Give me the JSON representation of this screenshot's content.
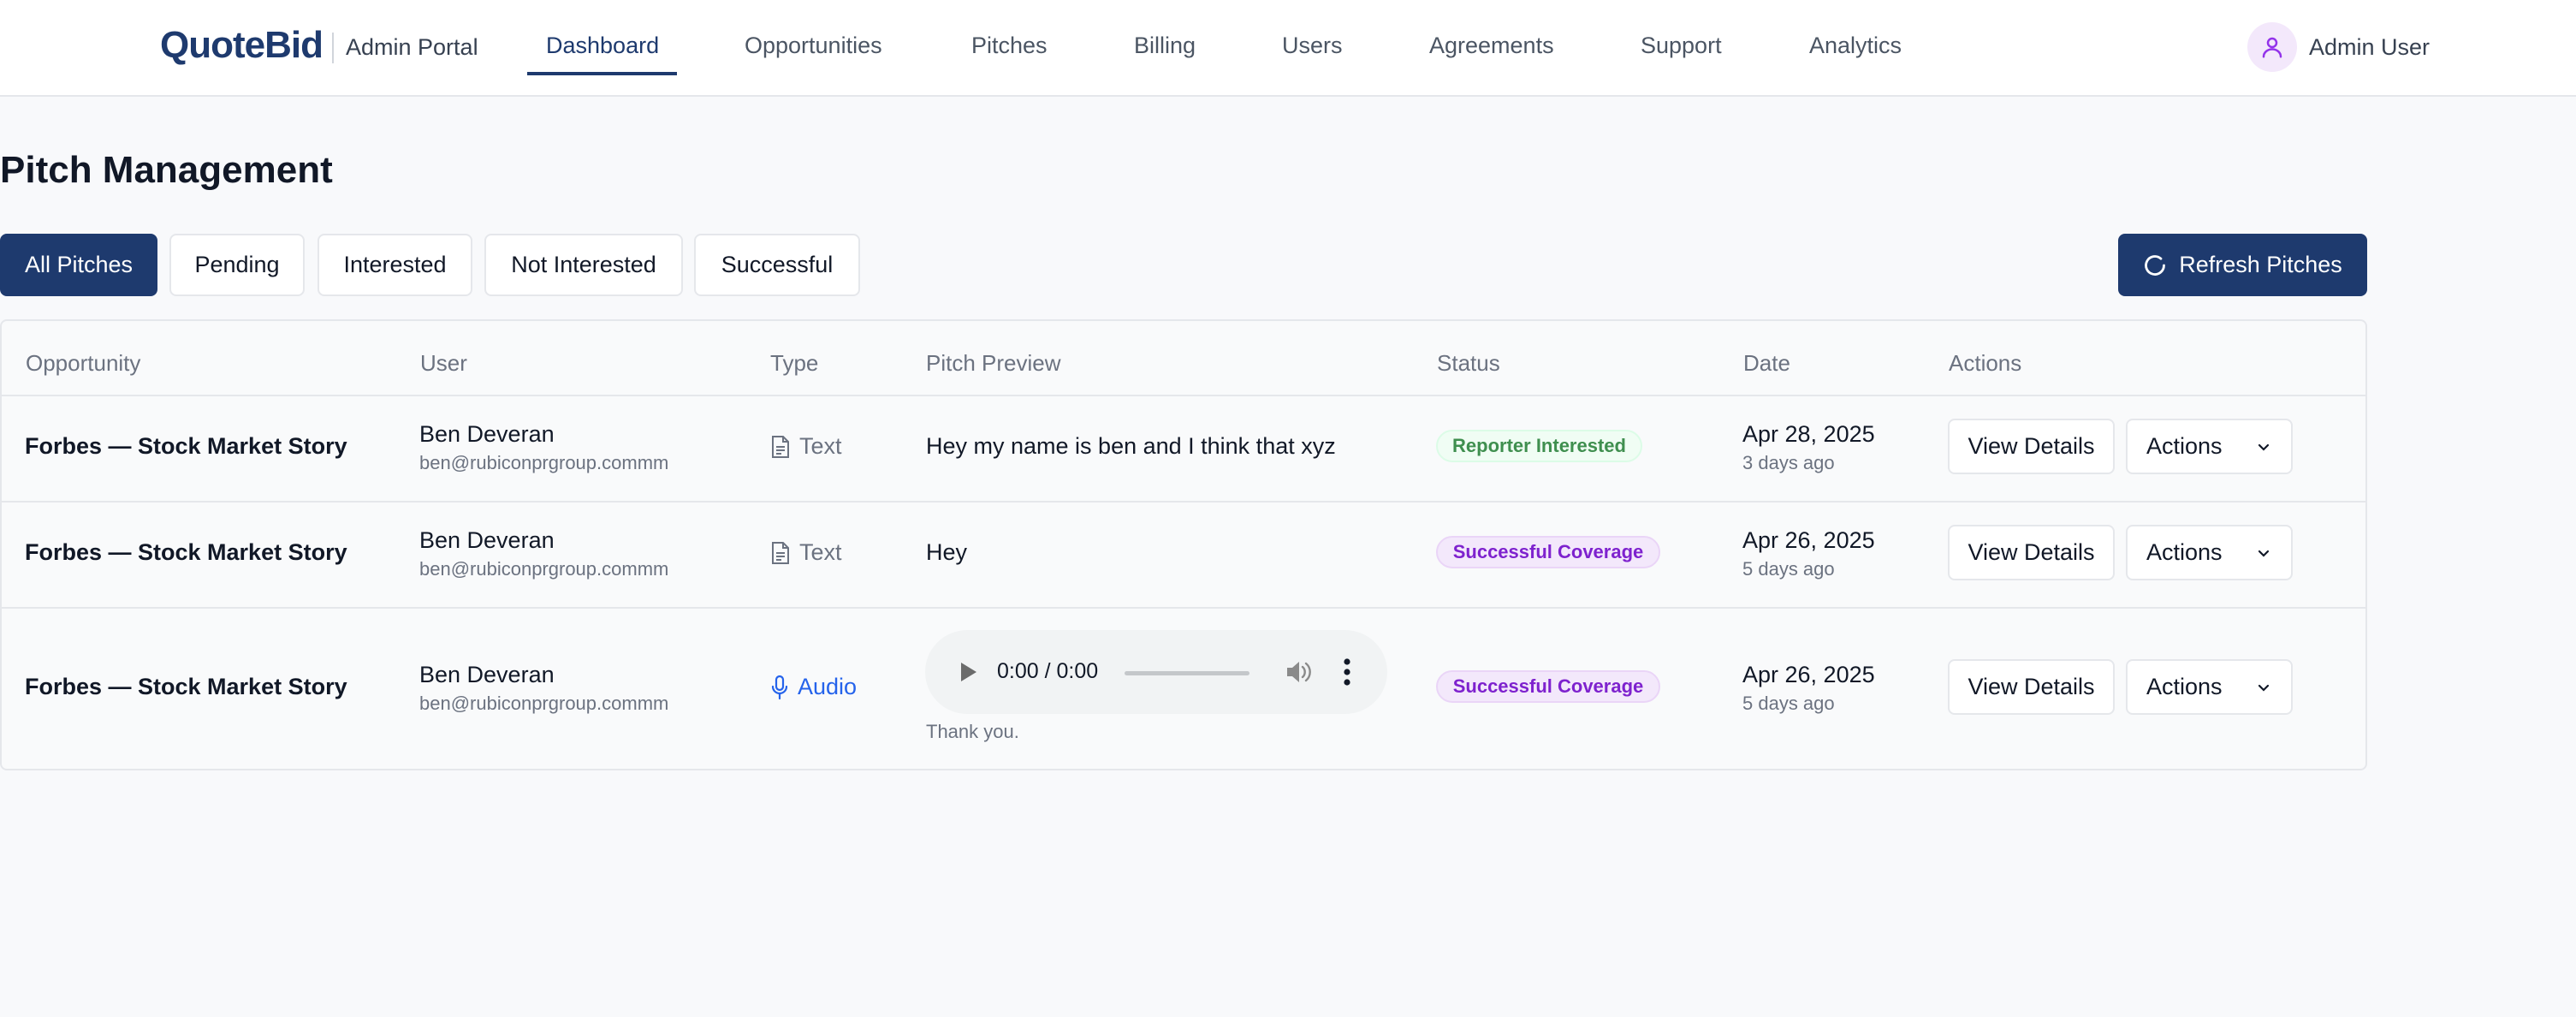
{
  "nav": {
    "brand": "QuoteBid",
    "portal": "Admin Portal",
    "links": [
      "Dashboard",
      "Opportunities",
      "Pitches",
      "Billing",
      "Users",
      "Agreements",
      "Support",
      "Analytics"
    ],
    "active": "Dashboard",
    "user": "Admin User",
    "user_icon": "user-icon"
  },
  "page": {
    "title": "Pitch Management"
  },
  "filters": {
    "tabs": [
      "All Pitches",
      "Pending",
      "Interested",
      "Not Interested",
      "Successful"
    ],
    "active": "All Pitches",
    "refresh_label": "Refresh Pitches",
    "refresh_icon": "refresh-icon"
  },
  "table": {
    "headers": [
      "Opportunity",
      "User",
      "Type",
      "Pitch Preview",
      "Status",
      "Date",
      "Actions"
    ],
    "rows": [
      {
        "opportunity": "Forbes — Stock Market Story",
        "user_name": "Ben Deveran",
        "user_email": "ben@rubiconprgroup.commm",
        "type": "Text",
        "type_icon": "document-icon",
        "preview": "Hey my name is ben and I think that xyz",
        "status": "Reporter Interested",
        "status_color": "green",
        "date": "Apr 28, 2025",
        "ago": "3 days ago",
        "view_label": "View Details",
        "actions_label": "Actions"
      },
      {
        "opportunity": "Forbes — Stock Market Story",
        "user_name": "Ben Deveran",
        "user_email": "ben@rubiconprgroup.commm",
        "type": "Text",
        "type_icon": "document-icon",
        "preview": "Hey",
        "status": "Successful Coverage",
        "status_color": "purple",
        "date": "Apr 26, 2025",
        "ago": "5 days ago",
        "view_label": "View Details",
        "actions_label": "Actions"
      },
      {
        "opportunity": "Forbes — Stock Market Story",
        "user_name": "Ben Deveran",
        "user_email": "ben@rubiconprgroup.commm",
        "type": "Audio",
        "type_icon": "microphone-icon",
        "audio_time": "0:00 / 0:00",
        "audio_caption": "Thank you.",
        "status": "Successful Coverage",
        "status_color": "purple",
        "date": "Apr 26, 2025",
        "ago": "5 days ago",
        "view_label": "View Details",
        "actions_label": "Actions"
      }
    ]
  },
  "colors": {
    "primary": "#1e3a6e",
    "background": "#f8f9fb",
    "badge_green": "#3f8f4f",
    "badge_purple": "#7e22ce",
    "audio_link": "#2563eb"
  }
}
